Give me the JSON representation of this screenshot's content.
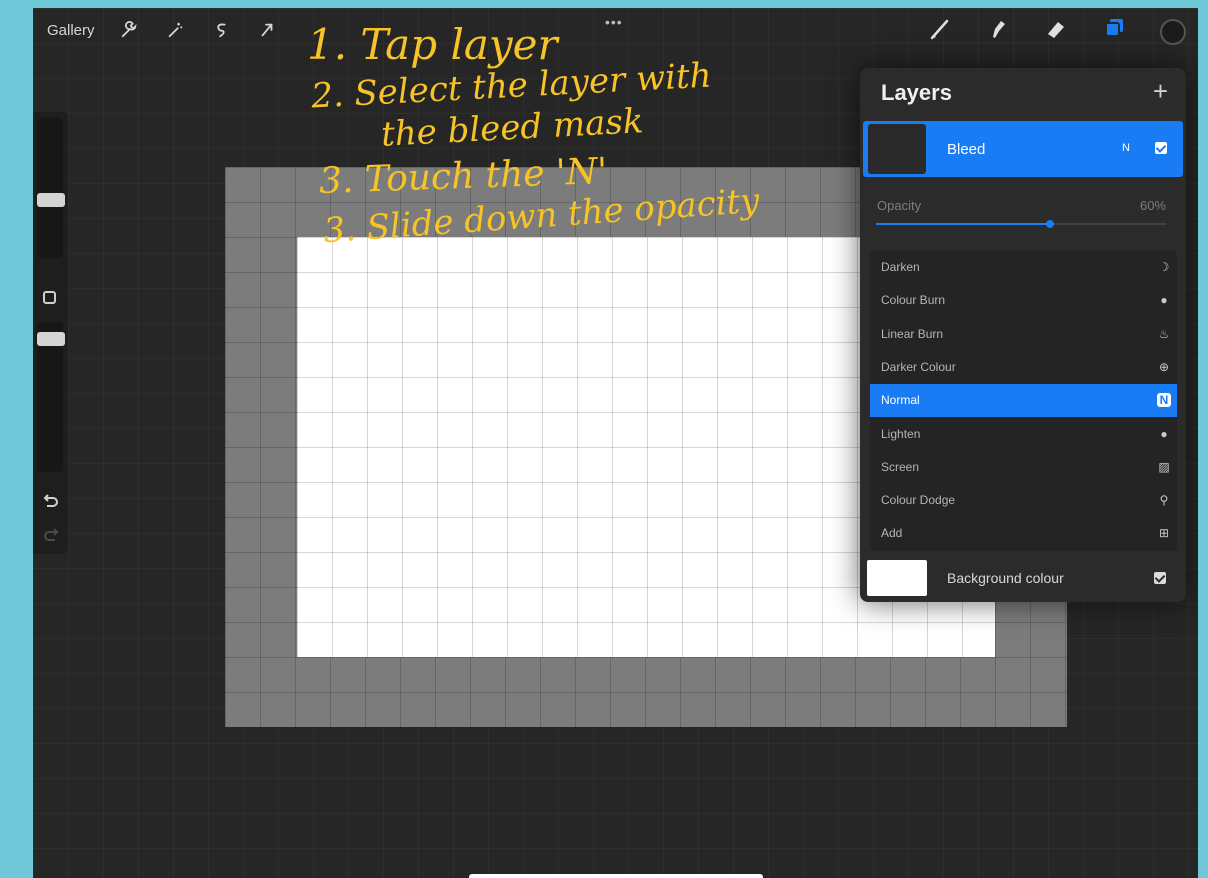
{
  "topbar": {
    "gallery_label": "Gallery",
    "left_icons": [
      "wrench-icon",
      "magic-wand-icon",
      "selection-icon",
      "transform-arrow-icon"
    ],
    "right_icons": [
      "brush-icon",
      "smudge-icon",
      "eraser-icon",
      "layers-icon",
      "color-swatch-icon"
    ],
    "menu_dots": "•••"
  },
  "annotation": {
    "line1": "1. Tap layer",
    "line2": "2. Select the layer with",
    "line3": "the bleed mask",
    "line4": "3. Touch the 'N'",
    "line5": "3. Slide down the opacity",
    "color": "#f7c326"
  },
  "layers_panel": {
    "title": "Layers",
    "add_label": "+",
    "active_layer": {
      "name": "Bleed",
      "blend_mode_short": "N",
      "visible": true
    },
    "opacity": {
      "label": "Opacity",
      "value_label": "60%",
      "value": 0.6
    },
    "blend_modes": [
      {
        "label": "Darken",
        "icon": "moon-icon",
        "selected": false
      },
      {
        "label": "Colour Burn",
        "icon": "burn-icon",
        "selected": false
      },
      {
        "label": "Linear Burn",
        "icon": "flame-icon",
        "selected": false
      },
      {
        "label": "Darker Colour",
        "icon": "plus-circle-icon",
        "selected": false
      },
      {
        "label": "Normal",
        "icon": "n-icon",
        "selected": true
      },
      {
        "label": "Lighten",
        "icon": "dot-icon",
        "selected": false
      },
      {
        "label": "Screen",
        "icon": "hatch-icon",
        "selected": false
      },
      {
        "label": "Colour Dodge",
        "icon": "dodge-icon",
        "selected": false
      },
      {
        "label": "Add",
        "icon": "plus-square-icon",
        "selected": false
      }
    ],
    "background_layer": {
      "label": "Background colour",
      "visible": true
    }
  },
  "colors": {
    "accent": "#1a7cf5",
    "frame": "#6ec8d8"
  }
}
